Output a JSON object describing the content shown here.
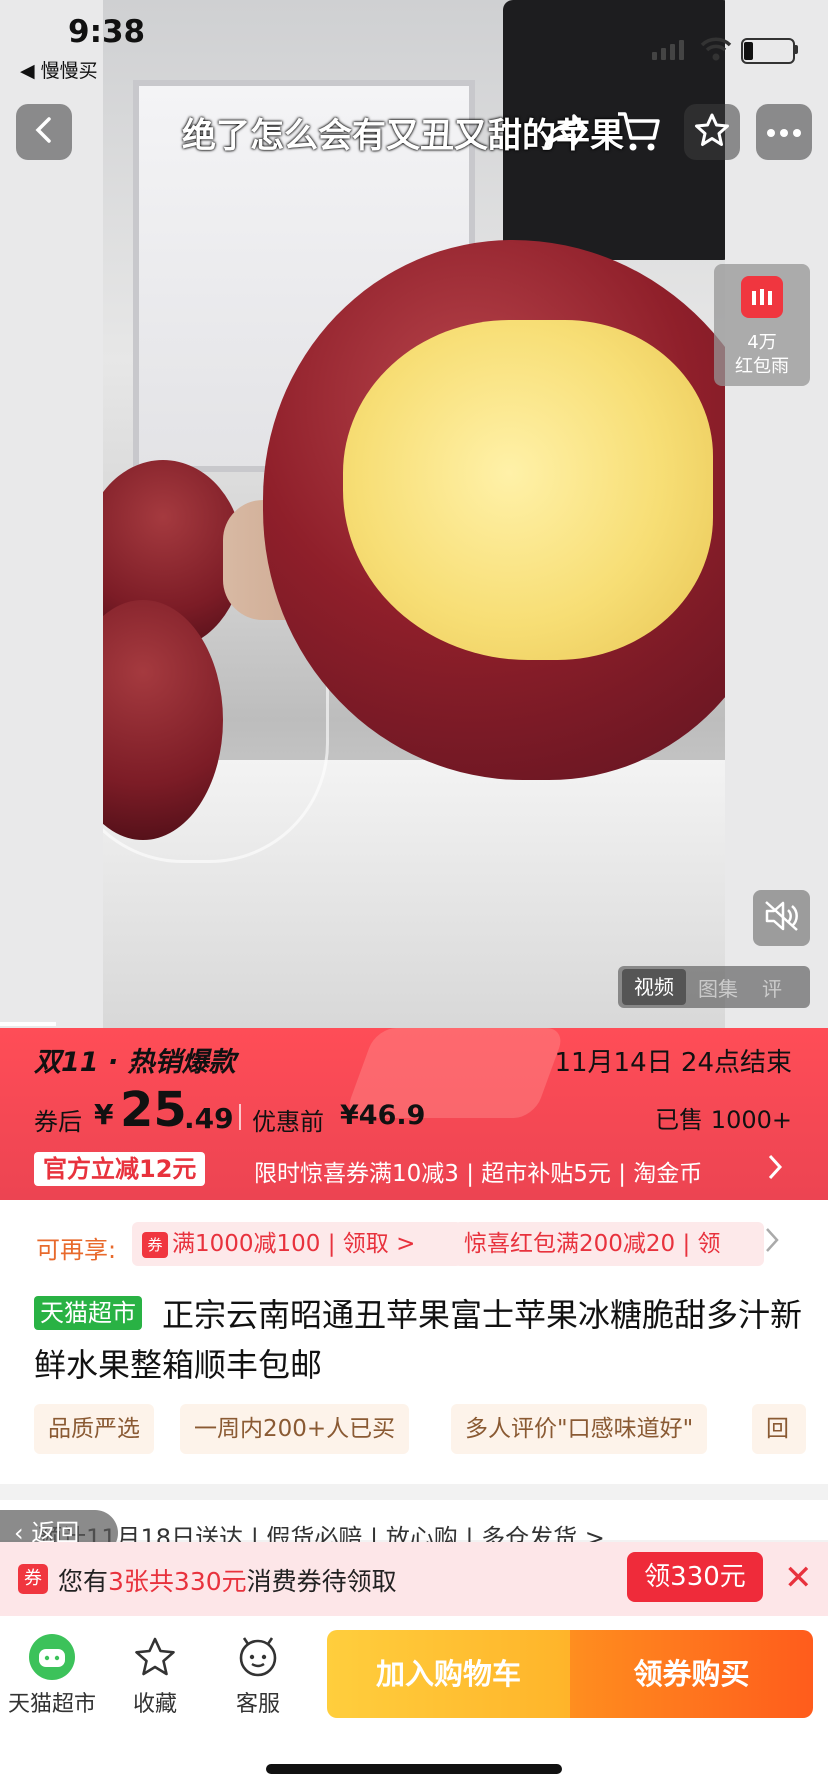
{
  "status": {
    "time": "9:38",
    "back_app": "◀ 慢慢买"
  },
  "video": {
    "caption": "绝了怎么会有又丑又甜的苹果",
    "redpack_amount": "4万",
    "redpack_label": "红包雨",
    "tabs": [
      "视频",
      "图集",
      "评"
    ]
  },
  "promo": {
    "event": "双11 · 热销爆款",
    "end_time": "11月14日 24点结束",
    "price_label": "券后",
    "price_symbol": "¥",
    "price_int": "25",
    "price_dec": ".49",
    "before_label": "优惠前",
    "before_price": "¥46.9",
    "sold": "已售 1000+",
    "official_badge": "官方立减12元",
    "items": "限时惊喜券满10减3 | 超市补贴5元 | 淘金币"
  },
  "coupons": {
    "prefix": "可再享:",
    "chip1_icon": "券",
    "chip1": "满1000减100 | 领取 >",
    "chip2": "惊喜红包满200减20 | 领"
  },
  "product": {
    "store_badge": "天猫超市",
    "title": "正宗云南昭通丑苹果富士苹果冰糖脆甜多汁新鲜水果整箱顺丰包邮",
    "tags": [
      "品质严选",
      "一周内200+人已买",
      "多人评价\"口感味道好\"",
      "回"
    ]
  },
  "shipping_partial": "预计11月18日送达 | 假货必赔 | 放心购 | 多仓发货 >",
  "back_pill": "返回",
  "notice": {
    "icon": "券",
    "text_prefix": "您有",
    "text_highlight": "3张共330元",
    "text_suffix": "消费券待领取",
    "button": "领330元",
    "close": "✕"
  },
  "bottom": {
    "items": [
      {
        "label": "天猫超市",
        "icon": "tmall-cat-icon"
      },
      {
        "label": "收藏",
        "icon": "star-outline-icon"
      },
      {
        "label": "客服",
        "icon": "service-face-icon"
      }
    ],
    "cart_button": "加入购物车",
    "buy_button": "领券购买"
  },
  "colors": {
    "accent": "#ec4452",
    "tmall_green": "#29b244",
    "cart": "#ffb42a",
    "buy": "#ff5c1c"
  }
}
